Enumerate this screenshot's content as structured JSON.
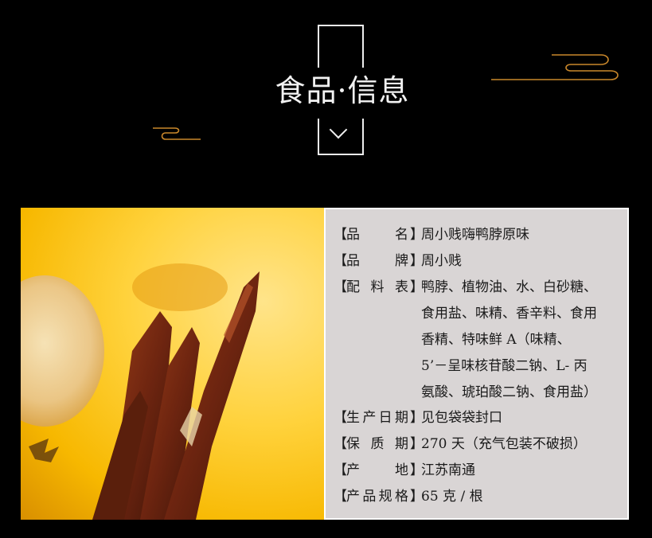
{
  "header": {
    "title": "食品·信息"
  },
  "info": {
    "rows": [
      {
        "label": [
          "品",
          "名"
        ],
        "value": [
          "周小贱嗨鸭脖原味"
        ]
      },
      {
        "label": [
          "品",
          "牌"
        ],
        "value": [
          "周小贱"
        ]
      },
      {
        "label": [
          "配",
          "料",
          "表"
        ],
        "value": [
          "鸭脖、植物油、水、白砂糖、",
          "食用盐、味精、香辛料、食用",
          "香精、特味鲜 A（味精、",
          "5’－呈味核苷酸二钠、L- 丙",
          "氨酸、琥珀酸二钠、食用盐）"
        ]
      },
      {
        "label": [
          "生",
          "产",
          "日",
          "期"
        ],
        "value": [
          "见包袋袋封口"
        ]
      },
      {
        "label": [
          "保",
          "质",
          "期"
        ],
        "value": [
          "270 天（充气包装不破损）"
        ]
      },
      {
        "label": [
          "产",
          "地"
        ],
        "value": [
          "江苏南通"
        ]
      },
      {
        "label": [
          "产",
          "品",
          "规",
          "格"
        ],
        "value": [
          "65 克 / 根"
        ]
      }
    ],
    "bracket_open": "【",
    "bracket_close": "】"
  },
  "colors": {
    "accent_gold": "#c9872a",
    "panel_bg": "#d9d5d5",
    "photo_yellow": "#ffd23c"
  }
}
